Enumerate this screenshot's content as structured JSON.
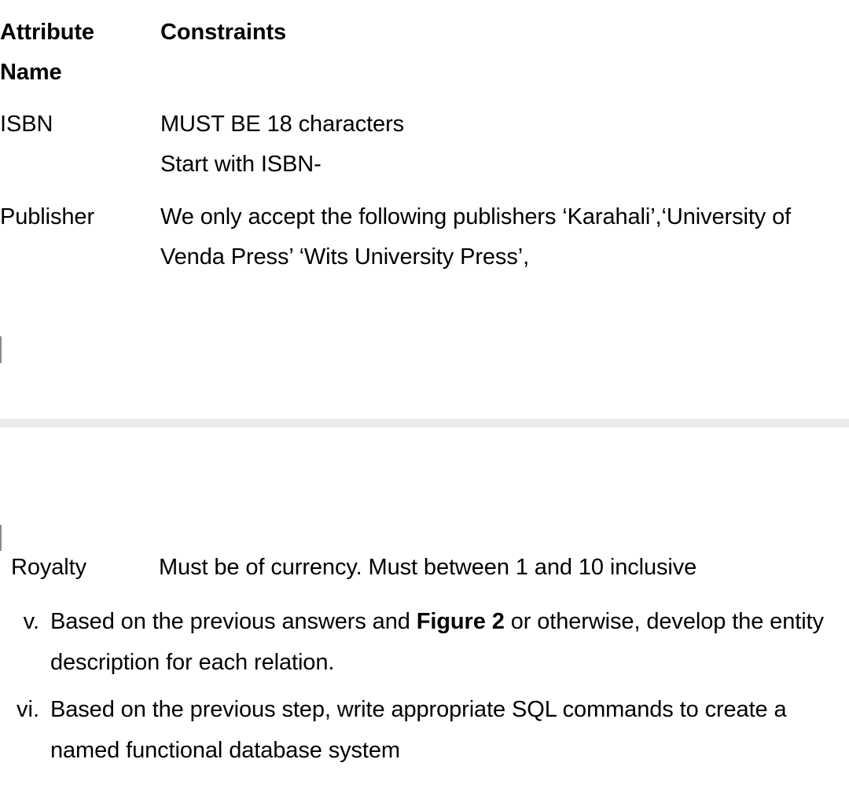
{
  "document": {
    "table": {
      "columns": [
        "Attribute Name",
        "Constraints"
      ],
      "header": {
        "attribute_line1": "Attribute",
        "attribute_line2": "Name",
        "constraints": "Constraints"
      },
      "rows": [
        {
          "attribute": "ISBN",
          "constraint_lines": [
            "MUST BE 18 characters",
            "Start with ISBN-"
          ]
        },
        {
          "attribute": "Publisher",
          "constraint_lines": [
            "We only accept the following publishers ‘Karahali’,‘University of Venda Press’ ‘Wits University Press’,"
          ]
        }
      ],
      "continued_rows": [
        {
          "attribute": "Royalty",
          "constraint_lines": [
            "Must be of currency. Must between 1 and 10 inclusive"
          ]
        }
      ]
    },
    "list": {
      "items": [
        {
          "marker": "v.",
          "text_before": "Based on the previous answers and ",
          "emphasis": "Figure 2",
          "text_after": " or otherwise, develop the entity description for each relation."
        },
        {
          "marker": "vi.",
          "text_before": "Based on the previous step, write appropriate SQL commands to create a named functional database system",
          "emphasis": "",
          "text_after": ""
        }
      ]
    },
    "colors": {
      "page_background": "#ffffff",
      "text": "#000000",
      "page_break_band": "#ececec",
      "caret_mark": "#8a8a8f"
    }
  }
}
